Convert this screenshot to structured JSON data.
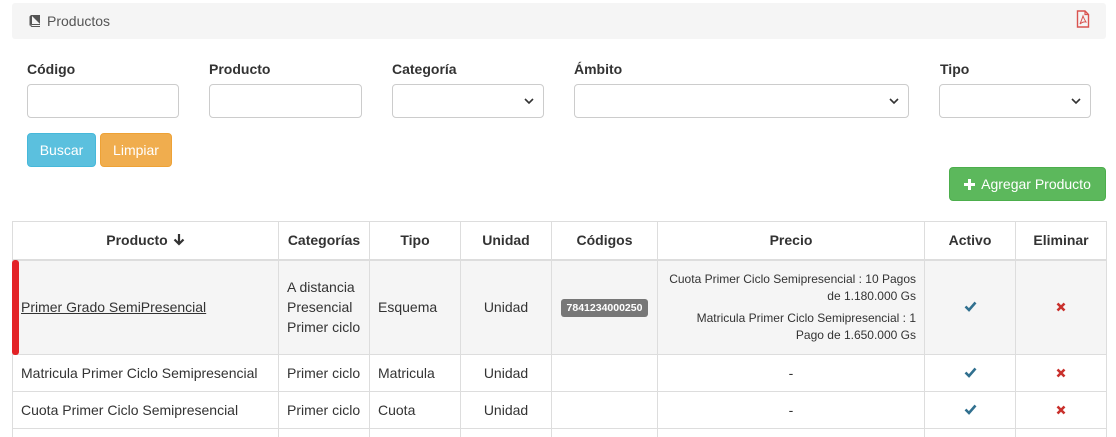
{
  "panel": {
    "title": "Productos",
    "title_icon": "book-icon",
    "export_icon": "pdf-icon"
  },
  "filters": {
    "codigo_label": "Código",
    "producto_label": "Producto",
    "categoria_label": "Categoría",
    "ambito_label": "Ámbito",
    "tipo_label": "Tipo",
    "codigo_value": "",
    "producto_value": "",
    "categoria_value": "",
    "ambito_value": "",
    "tipo_value": ""
  },
  "actions": {
    "search_label": "Buscar",
    "clear_label": "Limpiar",
    "add_label": "Agregar Producto"
  },
  "table": {
    "headers": [
      "Producto",
      "Categorías",
      "Tipo",
      "Unidad",
      "Códigos",
      "Precio",
      "Activo",
      "Eliminar"
    ],
    "sort_icon": "arrow-down-icon",
    "rows": [
      {
        "producto": "Primer Grado SemiPresencial",
        "categorias": [
          "A distancia",
          "Presencial",
          "Primer ciclo"
        ],
        "tipo": "Esquema",
        "unidad": "Unidad",
        "codigo": "7841234000250",
        "precios": [
          "Cuota Primer Ciclo Semipresencial : 10 Pagos de 1.180.000 Gs",
          "Matricula Primer Ciclo Semipresencial : 1 Pago de 1.650.000 Gs"
        ],
        "activo_icon": "check-icon",
        "eliminar_icon": "close-icon"
      },
      {
        "producto": "Matricula Primer Ciclo Semipresencial",
        "categorias": [
          "Primer ciclo"
        ],
        "tipo": "Matricula",
        "unidad": "Unidad",
        "codigo": "",
        "precio": "-",
        "activo_icon": "check-icon",
        "eliminar_icon": "close-icon"
      },
      {
        "producto": "Cuota Primer Ciclo Semipresencial",
        "categorias": [
          "Primer ciclo"
        ],
        "tipo": "Cuota",
        "unidad": "Unidad",
        "codigo": "",
        "precio": "-",
        "activo_icon": "check-icon",
        "eliminar_icon": "close-icon"
      }
    ]
  },
  "colors": {
    "info": "#5bc0de",
    "warning": "#f0ad4e",
    "success": "#5cb85c",
    "check": "#31708f",
    "delete": "#c9302c",
    "highlight": "#e32226"
  }
}
